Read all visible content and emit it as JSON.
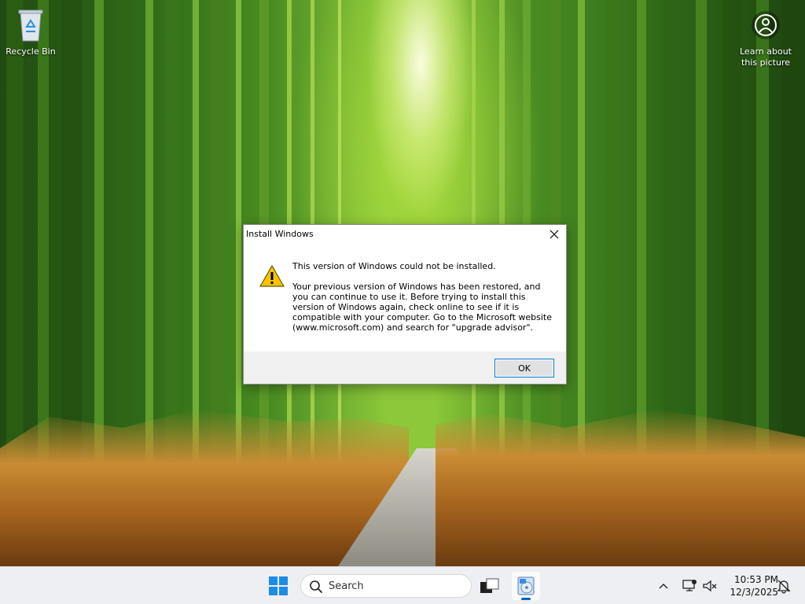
{
  "desktop": {
    "icons": [
      {
        "label": "Recycle Bin"
      },
      {
        "label": "Learn about this picture"
      }
    ]
  },
  "dialog": {
    "title": "Install Windows",
    "heading": "This version of Windows could not be installed.",
    "message": "Your previous version of Windows has been restored, and you can continue to use it.  Before trying to install this version of Windows again, check online to see if it is compatible with your computer.  Go to the Microsoft website (www.microsoft.com) and search for \"upgrade advisor\".",
    "ok_label": "OK",
    "icon": "warning-icon"
  },
  "taskbar": {
    "search_label": "Search",
    "time": "10:53 PM",
    "date": "12/3/2025"
  },
  "colors": {
    "accent": "#0078d4",
    "taskbar_bg": "#eeeff2",
    "warning_yellow": "#f5c400"
  }
}
